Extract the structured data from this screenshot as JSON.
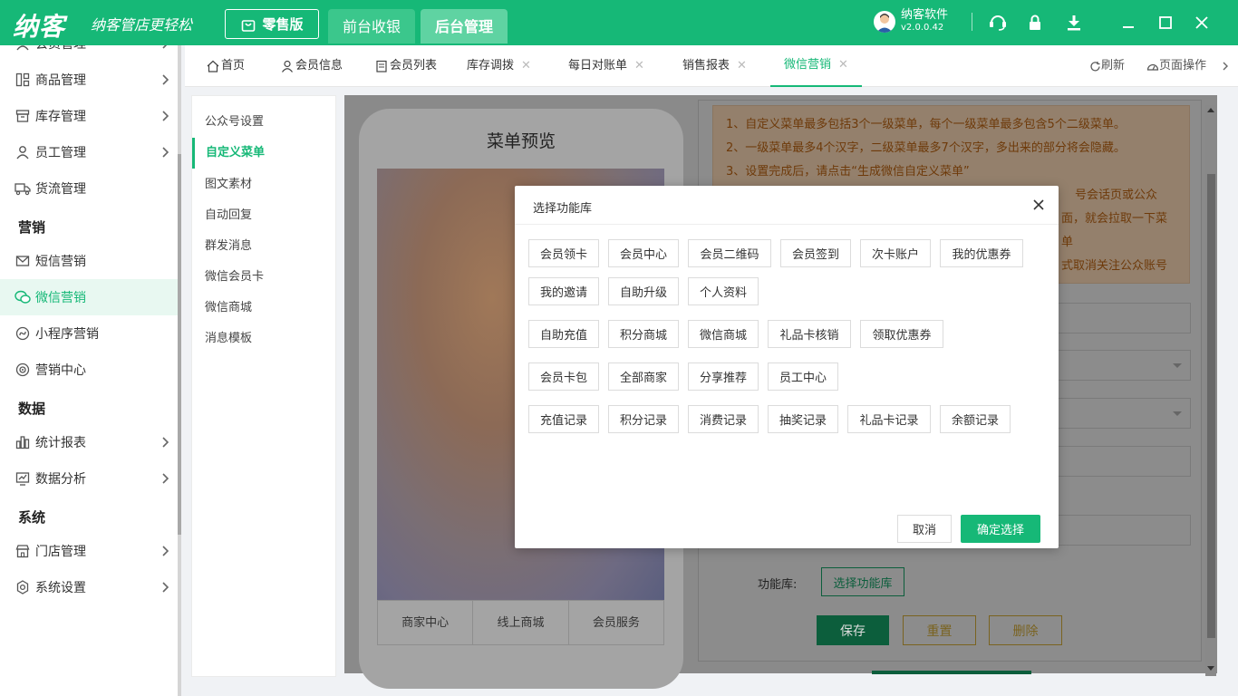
{
  "colors": {
    "brand": "#16b877",
    "notice_text": "#e8760f"
  },
  "topbar": {
    "logo": "纳客",
    "slogan": "纳客管店更轻松",
    "edition": "零售版",
    "nav": [
      {
        "label": "前台收银"
      },
      {
        "label": "后台管理"
      }
    ],
    "user_name": "纳客软件",
    "version": "v2.0.0.42"
  },
  "sidebar": {
    "items": [
      {
        "label": "会员管理",
        "icon": "member-icon",
        "chevron": true
      },
      {
        "label": "商品管理",
        "icon": "goods-icon",
        "chevron": true
      },
      {
        "label": "库存管理",
        "icon": "inventory-icon",
        "chevron": true
      },
      {
        "label": "员工管理",
        "icon": "staff-icon",
        "chevron": true
      },
      {
        "label": "货流管理",
        "icon": "truck-icon",
        "chevron": false
      }
    ],
    "sections": [
      "营销",
      "数据",
      "系统"
    ],
    "marketing": [
      {
        "label": "短信营销",
        "icon": "sms-icon"
      },
      {
        "label": "微信营销",
        "icon": "wechat-icon"
      },
      {
        "label": "小程序营销",
        "icon": "miniprogram-icon"
      },
      {
        "label": "营销中心",
        "icon": "target-icon"
      }
    ],
    "data": [
      {
        "label": "统计报表",
        "icon": "report-icon"
      },
      {
        "label": "数据分析",
        "icon": "analysis-icon"
      }
    ],
    "system": [
      {
        "label": "门店管理",
        "icon": "store-icon"
      },
      {
        "label": "系统设置",
        "icon": "gear-icon"
      }
    ]
  },
  "tabs": [
    {
      "label": "首页"
    },
    {
      "label": "会员信息"
    },
    {
      "label": "会员列表"
    },
    {
      "label": "库存调拨"
    },
    {
      "label": "每日对账单"
    },
    {
      "label": "销售报表"
    },
    {
      "label": "微信营销"
    }
  ],
  "tab_actions": {
    "refresh": "刷新",
    "page_ops": "页面操作"
  },
  "left_nav": [
    "公众号设置",
    "自定义菜单",
    "图文素材",
    "自动回复",
    "群发消息",
    "微信会员卡",
    "微信商城",
    "消息模板"
  ],
  "preview": {
    "title": "菜单预览",
    "bar": [
      "商家中心",
      "线上商城",
      "会员服务"
    ]
  },
  "notice": [
    "1、自定义菜单最多包括3个一级菜单，每个一级菜单最多包含5个二级菜单。",
    "2、一级菜单最多4个汉字，二级菜单最多7个汉字，多出来的部分将会隐藏。",
    "3、设置完成后，请点击“生成微信自定义菜单”",
    "号会话页或公众",
    "面，就会拉取一下菜单",
    "式取消关注公众账号"
  ],
  "form": {
    "func_label": "功能库:",
    "func_button": "选择功能库",
    "save": "保存",
    "reset": "重置",
    "delete": "删除"
  },
  "modal": {
    "title": "选择功能库",
    "rows": [
      [
        "会员领卡",
        "会员中心",
        "会员二维码",
        "会员签到",
        "次卡账户",
        "我的优惠券"
      ],
      [
        "我的邀请",
        "自助升级",
        "个人资料"
      ],
      [
        "自助充值",
        "积分商城",
        "微信商城",
        "礼品卡核销",
        "领取优惠券"
      ],
      [
        "会员卡包",
        "全部商家",
        "分享推荐",
        "员工中心"
      ],
      [
        "充值记录",
        "积分记录",
        "消费记录",
        "抽奖记录",
        "礼品卡记录",
        "余额记录"
      ]
    ],
    "cancel": "取消",
    "confirm": "确定选择"
  }
}
